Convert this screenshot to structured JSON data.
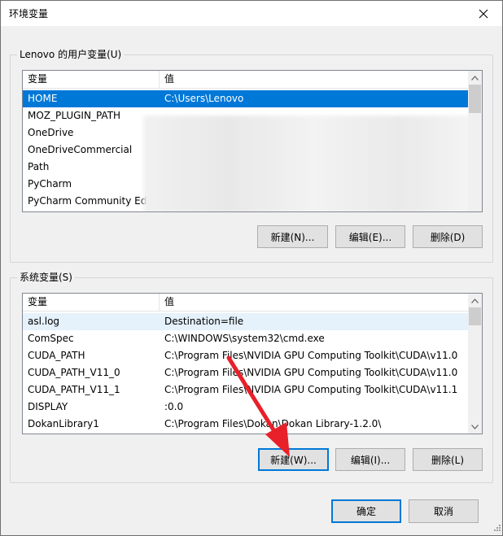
{
  "window": {
    "title": "环境变量"
  },
  "user_vars": {
    "group_label": "Lenovo 的用户变量(U)",
    "col_variable": "变量",
    "col_value": "值",
    "rows": [
      {
        "name": "HOME",
        "value": "C:\\Users\\Lenovo",
        "selected": true
      },
      {
        "name": "MOZ_PLUGIN_PATH",
        "value": ""
      },
      {
        "name": "OneDrive",
        "value": ""
      },
      {
        "name": "OneDriveCommercial",
        "value": ""
      },
      {
        "name": "Path",
        "value": ""
      },
      {
        "name": "PyCharm",
        "value": ""
      },
      {
        "name": "PyCharm Community Ed",
        "value": ""
      }
    ],
    "buttons": {
      "new": "新建(N)...",
      "edit": "编辑(E)...",
      "delete": "删除(D)"
    }
  },
  "system_vars": {
    "group_label": "系统变量(S)",
    "col_variable": "变量",
    "col_value": "值",
    "rows": [
      {
        "name": "asl.log",
        "value": "Destination=file",
        "highlighted": true
      },
      {
        "name": "ComSpec",
        "value": "C:\\WINDOWS\\system32\\cmd.exe"
      },
      {
        "name": "CUDA_PATH",
        "value": "C:\\Program Files\\NVIDIA GPU Computing Toolkit\\CUDA\\v11.0"
      },
      {
        "name": "CUDA_PATH_V11_0",
        "value": "C:\\Program Files\\NVIDIA GPU Computing Toolkit\\CUDA\\v11.0"
      },
      {
        "name": "CUDA_PATH_V11_1",
        "value": "C:\\Program Files\\NVIDIA GPU Computing Toolkit\\CUDA\\v11.1"
      },
      {
        "name": "DISPLAY",
        "value": ":0.0"
      },
      {
        "name": "DokanLibrary1",
        "value": "C:\\Program Files\\Dokan\\Dokan Library-1.2.0\\"
      }
    ],
    "buttons": {
      "new": "新建(W)...",
      "edit": "编辑(I)...",
      "delete": "删除(L)"
    }
  },
  "footer": {
    "ok": "确定",
    "cancel": "取消"
  },
  "colors": {
    "selection": "#0078d7",
    "annotation_arrow": "#e8202a"
  },
  "icons": {
    "close": "close-icon",
    "scroll_up": "chevron-up-icon",
    "scroll_down": "chevron-down-icon",
    "resize": "resize-grip-icon"
  }
}
